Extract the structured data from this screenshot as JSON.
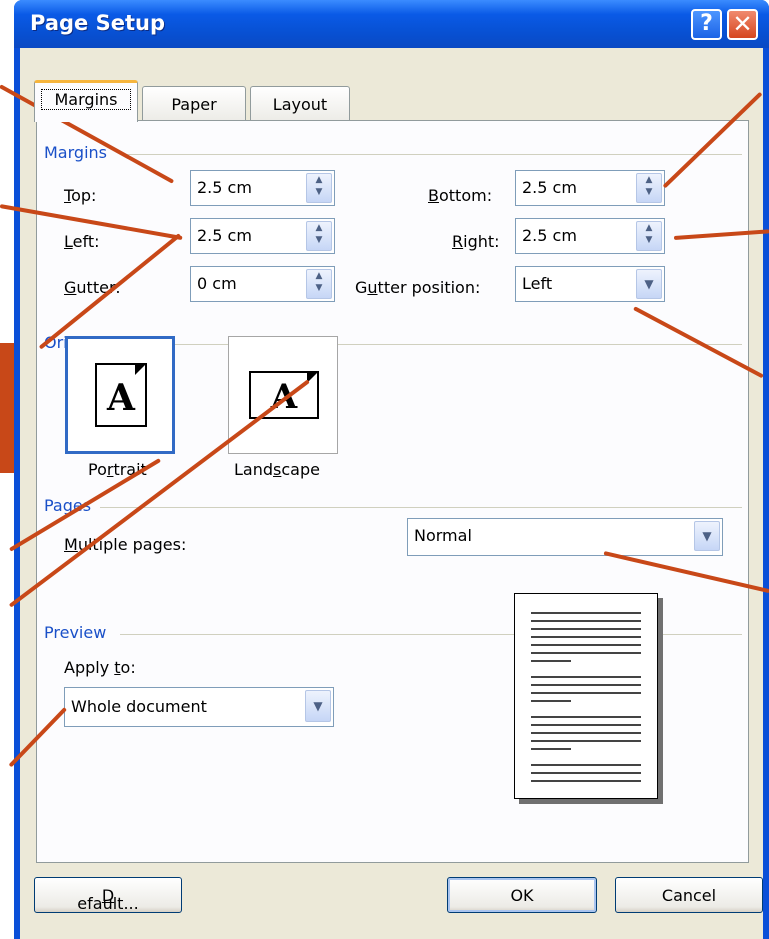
{
  "window": {
    "title": "Page Setup",
    "help_label": "?",
    "close_label": "✕"
  },
  "tabs": [
    {
      "label": "Margins",
      "active": true
    },
    {
      "label": "Paper",
      "active": false
    },
    {
      "label": "Layout",
      "active": false
    }
  ],
  "margins": {
    "group_label": "Margins",
    "top": {
      "label_pre": "",
      "label_u": "T",
      "label_post": "op:",
      "value": "2.5 cm"
    },
    "left": {
      "label_pre": "",
      "label_u": "L",
      "label_post": "eft:",
      "value": "2.5 cm"
    },
    "gutter": {
      "label_pre": "",
      "label_u": "G",
      "label_post": "utter:",
      "value": "0 cm"
    },
    "bottom": {
      "label_pre": "",
      "label_u": "B",
      "label_post": "ottom:",
      "value": "2.5 cm"
    },
    "right": {
      "label_pre": "",
      "label_u": "R",
      "label_post": "ight:",
      "value": "2.5 cm"
    },
    "gutter_position": {
      "label_pre": "G",
      "label_u": "u",
      "label_post": "tter position:",
      "value": "Left"
    }
  },
  "orientation": {
    "group_label": "Orientation",
    "portrait": {
      "label_pre": "Po",
      "label_u": "r",
      "label_post": "trait",
      "glyph": "A",
      "selected": true
    },
    "landscape": {
      "label_pre": "Land",
      "label_u": "s",
      "label_post": "cape",
      "glyph": "A",
      "selected": false
    }
  },
  "pages": {
    "group_label": "Pages",
    "multiple_pages": {
      "label_pre": "",
      "label_u": "M",
      "label_post": "ultiple pages:",
      "value": "Normal"
    }
  },
  "preview": {
    "group_label": "Preview",
    "apply_to": {
      "label_pre": "Apply ",
      "label_u": "t",
      "label_post": "o:",
      "value": "Whole document"
    }
  },
  "buttons": {
    "default": {
      "label_pre": "",
      "label_u": "D",
      "label_post": "efault..."
    },
    "ok": "OK",
    "cancel": "Cancel"
  },
  "icons": {
    "spin": "spin-arrows-icon",
    "dropdown": "chevron-down-icon"
  },
  "colors": {
    "accent": "#0a4fd8",
    "callout": "#c84818",
    "group_text": "#1a50c8",
    "tab_highlight": "#f6b53c"
  }
}
